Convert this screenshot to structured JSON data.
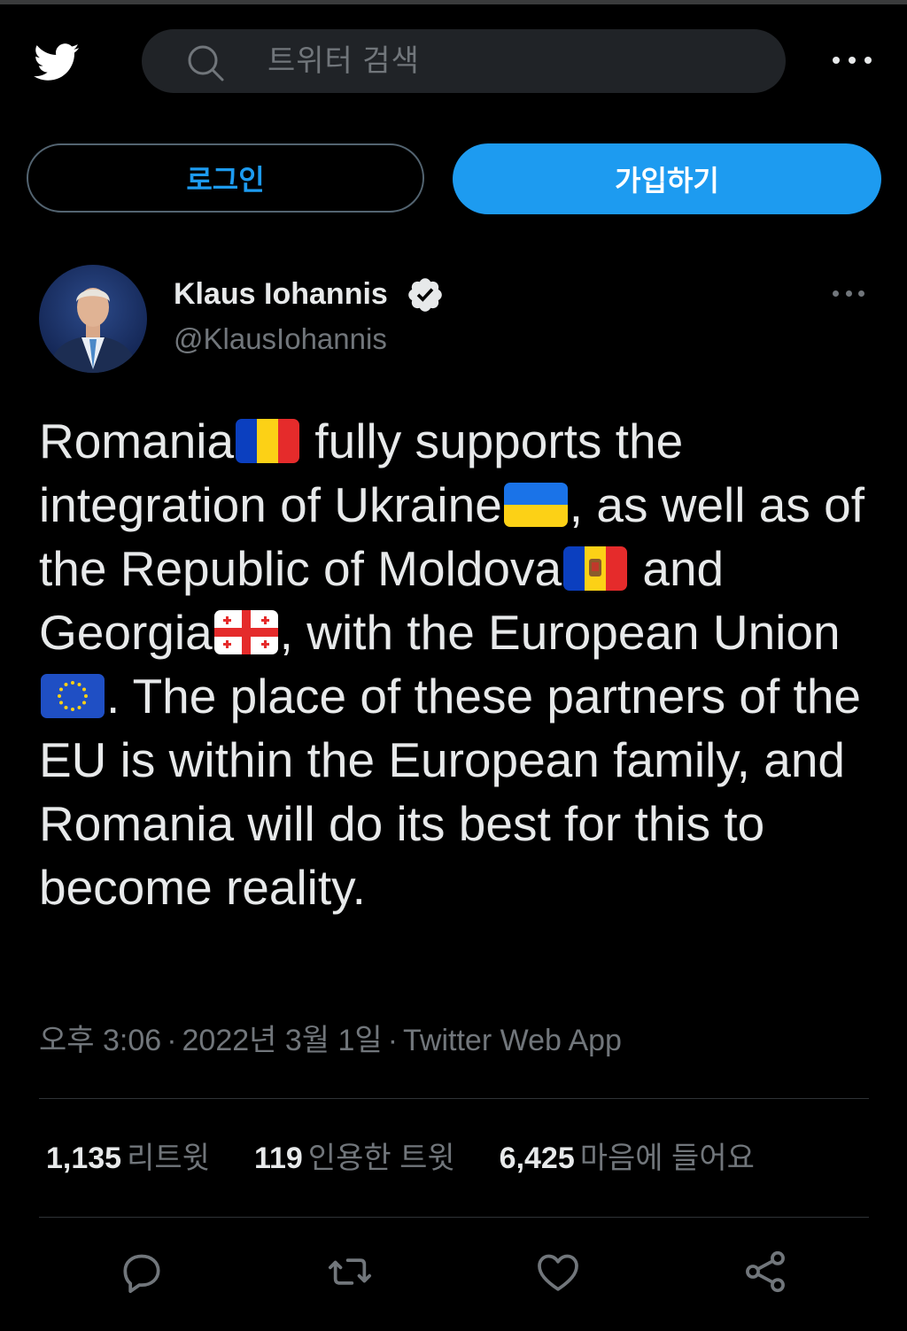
{
  "header": {
    "search_placeholder": "트위터 검색",
    "logo_icon": "twitter-bird-icon",
    "more_icon": "more-horizontal-icon"
  },
  "auth": {
    "login_label": "로그인",
    "signup_label": "가입하기"
  },
  "author": {
    "name": "Klaus Iohannis",
    "handle": "@KlausIohannis",
    "verified": true
  },
  "tweet": {
    "segments": [
      "Romania",
      " fully supports the integration of Ukraine",
      ", as well as of the Republic of Moldova",
      " and Georgia",
      ", with the European Union",
      ". The place of these partners of the EU is within the European family, and Romania will do its best for this to become reality."
    ],
    "flags": [
      "romania-flag-emoji",
      "ukraine-flag-emoji",
      "moldova-flag-emoji",
      "georgia-flag-emoji",
      "eu-flag-emoji"
    ]
  },
  "meta": {
    "time": "오후 3:06",
    "date": "2022년 3월 1일",
    "source": "Twitter Web App",
    "separator": "·"
  },
  "stats": {
    "retweets_count": "1,135",
    "retweets_label": "리트윗",
    "quotes_count": "119",
    "quotes_label": "인용한 트윗",
    "likes_count": "6,425",
    "likes_label": "마음에 들어요"
  },
  "actions": [
    "reply-icon",
    "retweet-icon",
    "like-icon",
    "share-icon"
  ],
  "colors": {
    "background": "#000000",
    "accent": "#1d9bf0",
    "text": "#e7e9ea",
    "muted": "#71767b"
  }
}
